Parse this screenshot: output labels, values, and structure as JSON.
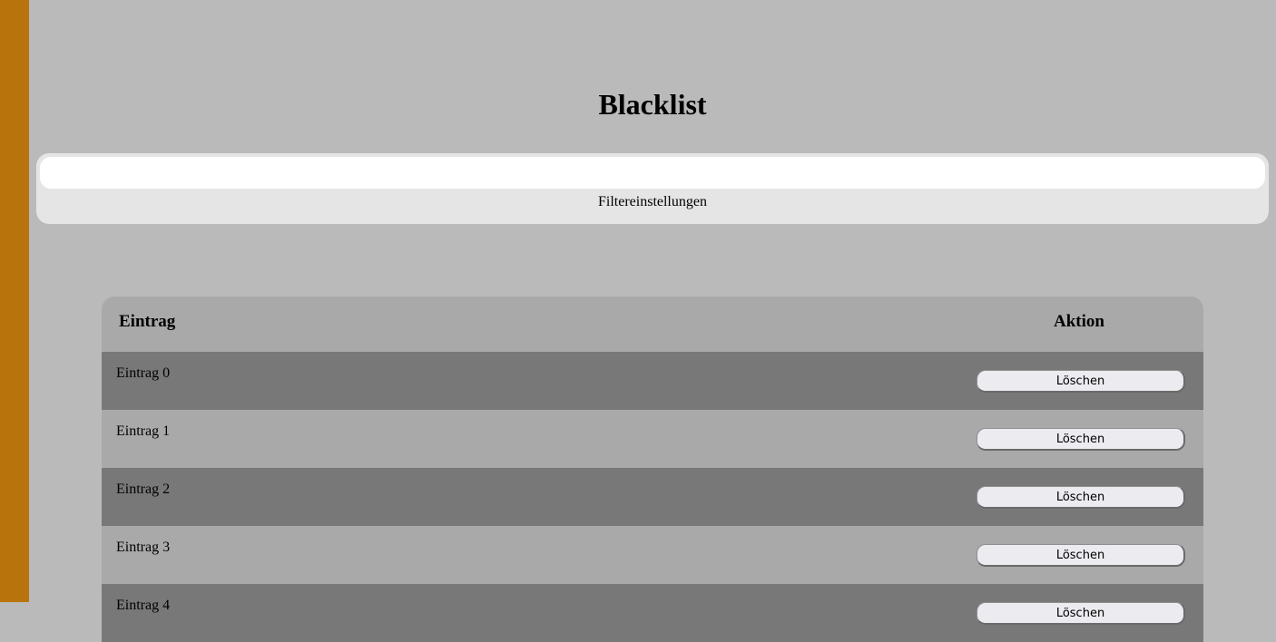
{
  "page": {
    "title": "Blacklist"
  },
  "filter": {
    "input_value": "",
    "label": "Filtereinstellungen"
  },
  "table": {
    "headers": {
      "entry": "Eintrag",
      "action": "Aktion"
    },
    "rows": [
      {
        "label": "Eintrag 0",
        "button": "Löschen"
      },
      {
        "label": "Eintrag 1",
        "button": "Löschen"
      },
      {
        "label": "Eintrag 2",
        "button": "Löschen"
      },
      {
        "label": "Eintrag 3",
        "button": "Löschen"
      },
      {
        "label": "Eintrag 4",
        "button": "Löschen"
      }
    ]
  },
  "colors": {
    "background": "#bababa",
    "sidebar_accent": "#b8730d",
    "row_dark": "#787878",
    "row_light": "#a9a9a9",
    "panel": "#e5e5e5"
  }
}
